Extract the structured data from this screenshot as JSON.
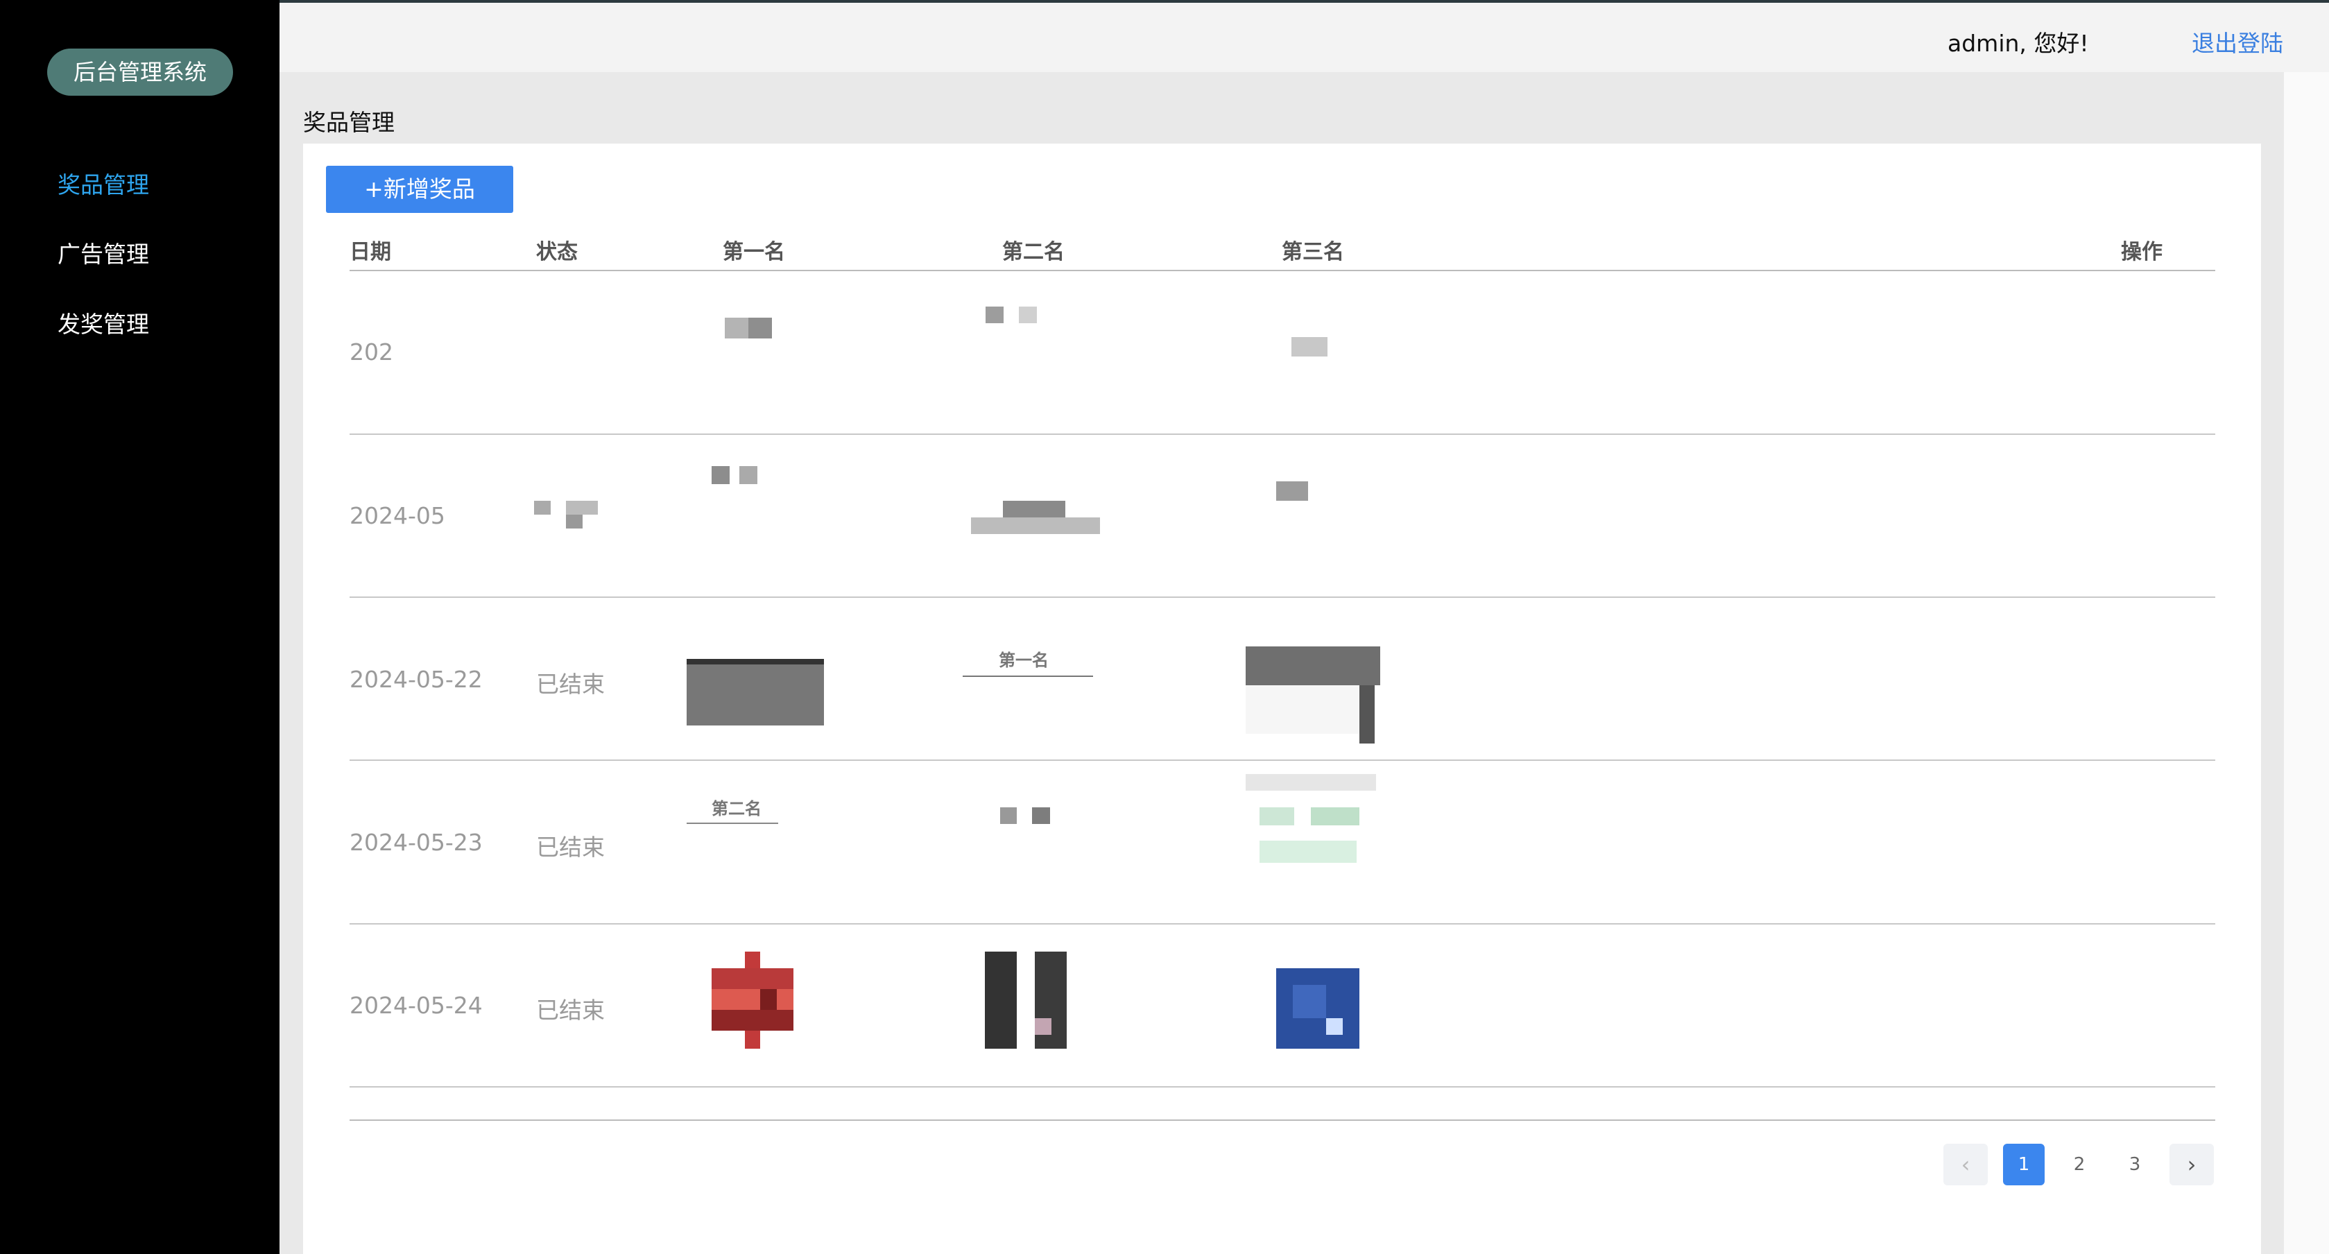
{
  "app": {
    "title": "后台管理系统"
  },
  "sidebar": {
    "items": [
      {
        "label": "奖品管理",
        "active": true
      },
      {
        "label": "广告管理",
        "active": false
      },
      {
        "label": "发奖管理",
        "active": false
      }
    ]
  },
  "header": {
    "greeting": "admin, 您好!",
    "logout": "退出登陆"
  },
  "page": {
    "title": "奖品管理",
    "add_button": "+新增奖品"
  },
  "table": {
    "columns": [
      "日期",
      "状态",
      "第一名",
      "第二名",
      "第三名",
      "操作"
    ],
    "rows": [
      {
        "date": "202",
        "status": ""
      },
      {
        "date": "2024-05",
        "status": ""
      },
      {
        "date": "2024-05-22",
        "status": "已结束",
        "thumb_labels": {
          "second": "第一名"
        }
      },
      {
        "date": "2024-05-23",
        "status": "已结束",
        "thumb_labels": {
          "first": "第二名"
        }
      },
      {
        "date": "2024-05-24",
        "status": "已结束"
      }
    ]
  },
  "pagination": {
    "pages": [
      "1",
      "2",
      "3"
    ],
    "current": "1",
    "prev_icon": "chevron-left-icon",
    "next_icon": "chevron-right-icon"
  },
  "colors": {
    "sidebar_bg": "#000000",
    "brand_pill": "#4f7b76",
    "active_nav": "#2ea5ee",
    "primary": "#3b86ee",
    "logout_link": "#3a7fe0"
  }
}
